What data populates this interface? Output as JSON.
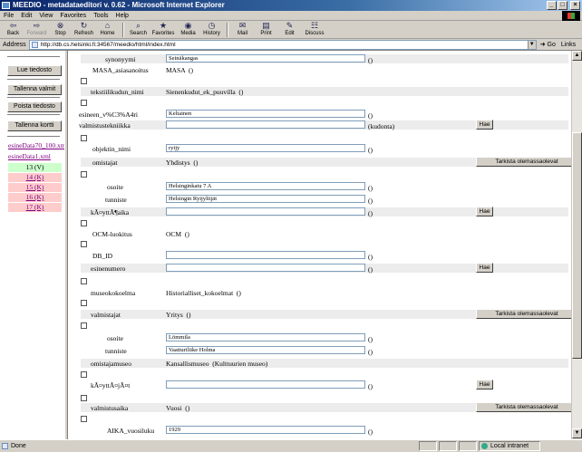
{
  "window": {
    "title": "MEEDIO - metadataeditori v. 0.62 - Microsoft Internet Explorer"
  },
  "menu": [
    "File",
    "Edit",
    "View",
    "Favorites",
    "Tools",
    "Help"
  ],
  "toolbar": [
    {
      "label": "Back",
      "icon": "back-arrow-icon",
      "glyph": "⇦"
    },
    {
      "label": "Forward",
      "icon": "forward-arrow-icon",
      "glyph": "⇨"
    },
    {
      "label": "Stop",
      "icon": "stop-icon",
      "glyph": "⊗"
    },
    {
      "label": "Refresh",
      "icon": "refresh-icon",
      "glyph": "↻"
    },
    {
      "label": "Home",
      "icon": "home-icon",
      "glyph": "⌂"
    },
    {
      "label": "Search",
      "icon": "search-icon",
      "glyph": "⌕"
    },
    {
      "label": "Favorites",
      "icon": "favorites-icon",
      "glyph": "★"
    },
    {
      "label": "Media",
      "icon": "media-icon",
      "glyph": "◉"
    },
    {
      "label": "History",
      "icon": "history-icon",
      "glyph": "◷"
    },
    {
      "label": "Mail",
      "icon": "mail-icon",
      "glyph": "✉"
    },
    {
      "label": "Print",
      "icon": "print-icon",
      "glyph": "▤"
    },
    {
      "label": "Edit",
      "icon": "edit-icon",
      "glyph": "✎"
    },
    {
      "label": "Discuss",
      "icon": "discuss-icon",
      "glyph": "☷"
    }
  ],
  "address": {
    "label": "Address",
    "url": "http://db.cs.helsinki.fi:34567/meedio/html/index.html",
    "go": "Go",
    "links": "Links"
  },
  "left": {
    "buttons": [
      "Lue tiedosto",
      "Tallenna valmit",
      "Poista tiedosto",
      "Tallenna kortti"
    ],
    "files": [
      "esineData70_100.xml",
      "esineData1.xml"
    ],
    "records": [
      {
        "label": "13 (V)",
        "state": "active"
      },
      {
        "label": "14 (K)",
        "state": "pending"
      },
      {
        "label": "15 (K)",
        "state": "pending"
      },
      {
        "label": "16 (K)",
        "state": "pending"
      },
      {
        "label": "17 (K)",
        "state": "pending"
      }
    ]
  },
  "form": {
    "synonyymi_label": "synonyymi",
    "synonyymi_value": "Seinäkangas",
    "masa_label": "MASA_asiasanoitus",
    "masa_value": "MASA",
    "tekstiili_label": "tekstiilikudun_nimi",
    "tekstiili_value": "Sienenkudut_ek_puuvilla",
    "esineen_label": "esineen_v%C3%A4ri",
    "esineen_value": "Keltainen",
    "valmistustekniikka_label": "valmistustekniikka",
    "valmistustekniikka_value": "",
    "kudonta": "(kudonta)",
    "objektin_label": "objektin_nimi",
    "objektin_value": "ryijy",
    "omistajat_label": "omistajat",
    "omistajat_value": "Yhdistys",
    "osoite_label": "osoite",
    "osoite1_value": "Helsinginkatu 7 A",
    "tunniste_label": "tunniste",
    "tunniste1_value": "Helsingin Ryijyliijät",
    "kaytto_label": "kÃ¤yttÃ¶aika",
    "kaytto_value": "",
    "ocm_label": "OCM-luokitus",
    "ocm_value": "OCM",
    "db_label": "DB_ID",
    "db_value": "",
    "esinenumero_label": "esinenumero",
    "esinenumero_value": "",
    "museo_label": "museokokoelma",
    "museo_value": "Historialliset_kokoelmat",
    "valmistajat_label": "valmistajat",
    "valmistajat_value": "Yritys",
    "osoite2_value": "Lömmila",
    "tunniste2_value": "Vaatturiliike Holma",
    "omistajamuseo_label": "omistajamuseo",
    "omistajamuseo_value": "Kansallismuseo",
    "omistajamuseo_extra": "(Kulttuurien museo)",
    "kayttajat_label": "kÃ¤yttÃ¤jÃ¤t",
    "kayttajat_value": "",
    "valmistusaika_label": "valmistusaika",
    "valmistusaika_value": "Vuosi",
    "aika_label": "AIKA_vuosiluku",
    "aika_value": "1929",
    "empty_parens": "()",
    "hae": "Hae",
    "tarkista": "Tarkista olemassaolevat"
  },
  "status": {
    "left": "Done",
    "zone": "Local intranet"
  }
}
